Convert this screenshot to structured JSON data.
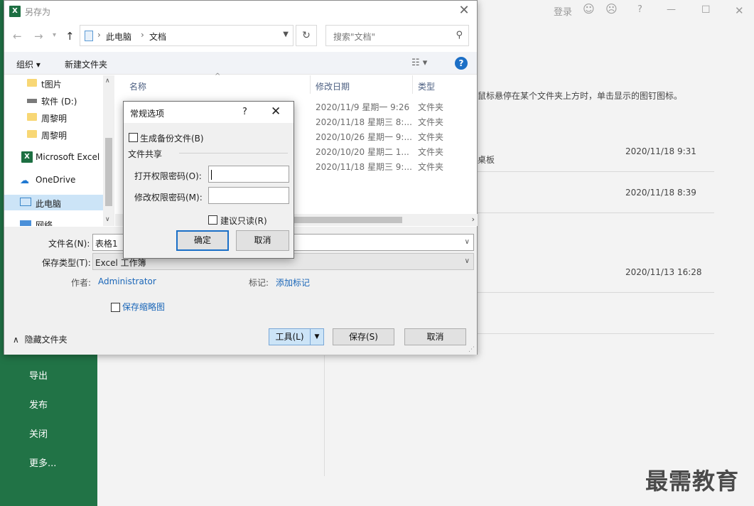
{
  "background": {
    "topbar": {
      "login": "登录"
    },
    "nav": [
      "导出",
      "发布",
      "关闭",
      "更多..."
    ],
    "hint_text": "鼠标悬停在某个文件夹上方时，单击显示的图钉图标。",
    "partial_text": "桌板",
    "recent_dates": [
      "2020/11/18 9:31",
      "2020/11/18 8:39",
      "2020/11/13 16:28"
    ],
    "watermark": "最需教育"
  },
  "saveas": {
    "title": "另存为",
    "breadcrumb": [
      "此电脑",
      "文档"
    ],
    "search_placeholder": "搜索\"文档\"",
    "organize": "组织",
    "new_folder": "新建文件夹",
    "tree_items": [
      "t图片",
      "软件 (D:)",
      "周黎明",
      "周黎明",
      "Microsoft Excel",
      "OneDrive",
      "此电脑",
      "网络"
    ],
    "columns": {
      "name": "名称",
      "date": "修改日期",
      "type": "类型"
    },
    "files": [
      {
        "date": "2020/11/9 星期一 9:26",
        "type": "文件夹"
      },
      {
        "date": "2020/11/18 星期三 8:...",
        "type": "文件夹"
      },
      {
        "date": "2020/10/26 星期一 9:...",
        "type": "文件夹"
      },
      {
        "date": "2020/10/20 星期二 1...",
        "type": "文件夹"
      },
      {
        "date": "2020/11/18 星期三 9:...",
        "type": "文件夹"
      }
    ],
    "filename_label": "文件名(N):",
    "filename_value": "表格1",
    "filetype_label": "保存类型(T):",
    "filetype_value": "Excel 工作簿",
    "author_label": "作者:",
    "author_value": "Administrator",
    "tags_label": "标记:",
    "tags_value": "添加标记",
    "thumbnail_label": "保存缩略图",
    "hide_folders": "隐藏文件夹",
    "tools_button": "工具(L)",
    "save_button": "保存(S)",
    "cancel_button": "取消"
  },
  "general_options": {
    "title": "常规选项",
    "help": "?",
    "backup_label": "生成备份文件(B)",
    "file_sharing": "文件共享",
    "open_password_label": "打开权限密码(O):",
    "open_password_value": "",
    "modify_password_label": "修改权限密码(M):",
    "modify_password_value": "",
    "readonly_label": "建议只读(R)",
    "ok_button": "确定",
    "cancel_button": "取消"
  }
}
